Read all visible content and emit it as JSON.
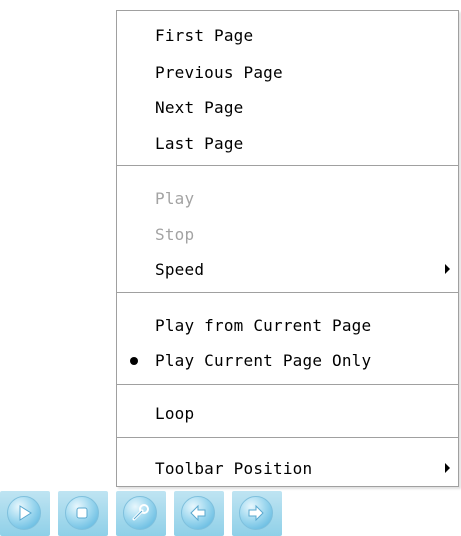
{
  "menu": {
    "items": [
      {
        "label": "First Page",
        "disabled": false
      },
      {
        "label": "Previous Page",
        "disabled": false
      },
      {
        "label": "Next Page",
        "disabled": false
      },
      {
        "label": "Last Page",
        "disabled": false
      },
      {
        "label": "Play",
        "disabled": true
      },
      {
        "label": "Stop",
        "disabled": true
      },
      {
        "label": "Speed",
        "disabled": false,
        "submenu": true
      },
      {
        "label": "Play from Current Page",
        "disabled": false
      },
      {
        "label": "Play Current Page Only",
        "disabled": false,
        "selected": true
      },
      {
        "label": "Loop",
        "disabled": false
      },
      {
        "label": "Toolbar Position",
        "disabled": false,
        "submenu": true
      }
    ]
  },
  "toolbar": {
    "buttons": [
      {
        "icon": "play-icon"
      },
      {
        "icon": "stop-icon"
      },
      {
        "icon": "wrench-icon"
      },
      {
        "icon": "arrow-left-icon"
      },
      {
        "icon": "arrow-right-icon"
      }
    ]
  },
  "colors": {
    "menu_border": "#a0a0a0",
    "disabled_text": "#a3a3a3",
    "toolbar_blue": "#8fd0e8"
  }
}
